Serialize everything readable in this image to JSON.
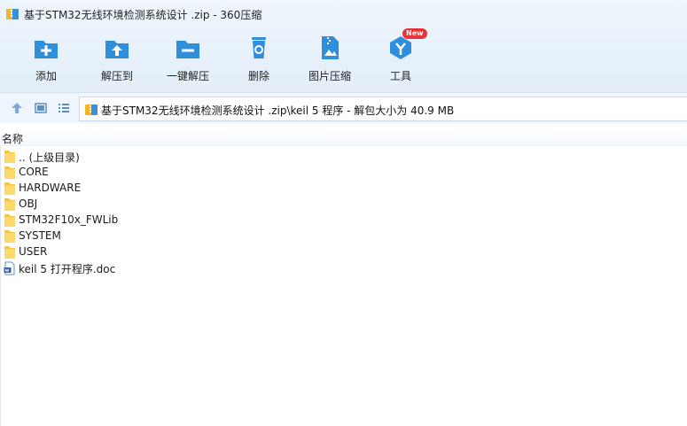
{
  "window": {
    "title": "基于STM32无线环境检测系统设计 .zip - 360压缩"
  },
  "toolbar": {
    "items": [
      {
        "label": "添加",
        "icon": "add-icon"
      },
      {
        "label": "解压到",
        "icon": "extract-to-icon"
      },
      {
        "label": "一键解压",
        "icon": "one-click-extract-icon"
      },
      {
        "label": "删除",
        "icon": "delete-icon"
      },
      {
        "label": "图片压缩",
        "icon": "image-compress-icon"
      },
      {
        "label": "工具",
        "icon": "tools-icon",
        "badge": "New"
      }
    ]
  },
  "address": {
    "path": "基于STM32无线环境检测系统设计 .zip\\keil 5 程序 - 解包大小为 40.9 MB"
  },
  "list": {
    "column_name": "名称",
    "items": [
      {
        "name": ".. (上级目录)",
        "type": "folder"
      },
      {
        "name": "CORE",
        "type": "folder"
      },
      {
        "name": "HARDWARE",
        "type": "folder"
      },
      {
        "name": "OBJ",
        "type": "folder"
      },
      {
        "name": "STM32F10x_FWLib",
        "type": "folder"
      },
      {
        "name": "SYSTEM",
        "type": "folder"
      },
      {
        "name": "USER",
        "type": "folder"
      },
      {
        "name": "keil 5 打开程序.doc",
        "type": "doc"
      }
    ]
  },
  "colors": {
    "accent": "#2f8fdc",
    "badge": "#e8333a",
    "folder": "#f5c242"
  }
}
